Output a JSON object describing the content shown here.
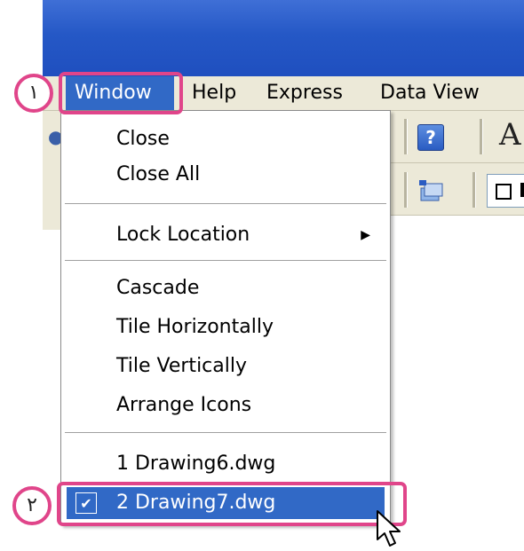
{
  "menubar": {
    "items": [
      {
        "label": "Window"
      },
      {
        "label": "Help"
      },
      {
        "label": "Express"
      },
      {
        "label": "Data View"
      }
    ]
  },
  "toolbar": {
    "help_icon_glyph": "?",
    "text_tool_glyph": "A"
  },
  "window_menu": {
    "items": [
      {
        "label": "Close"
      },
      {
        "label": "Close All"
      },
      {
        "label": "Lock Location",
        "submenu": true,
        "arrow": "▶"
      },
      {
        "label": "Cascade"
      },
      {
        "label": "Tile Horizontally"
      },
      {
        "label": "Tile Vertically"
      },
      {
        "label": "Arrange Icons"
      },
      {
        "label": "1 Drawing6.dwg"
      },
      {
        "label": "2 Drawing7.dwg",
        "checked": true,
        "check_glyph": "✔"
      }
    ]
  },
  "callouts": {
    "step1": "١",
    "step2": "٢"
  },
  "colors": {
    "highlight": "#e0458a",
    "menu_selection": "#3169c6",
    "titlebar": "#2558c6",
    "menubar_bg": "#ece9d8"
  },
  "icons": [
    "help-icon",
    "text-tool-icon",
    "layers-icon",
    "checkbox-icon",
    "submenu-arrow-icon",
    "check-icon",
    "mouse-pointer-icon"
  ]
}
